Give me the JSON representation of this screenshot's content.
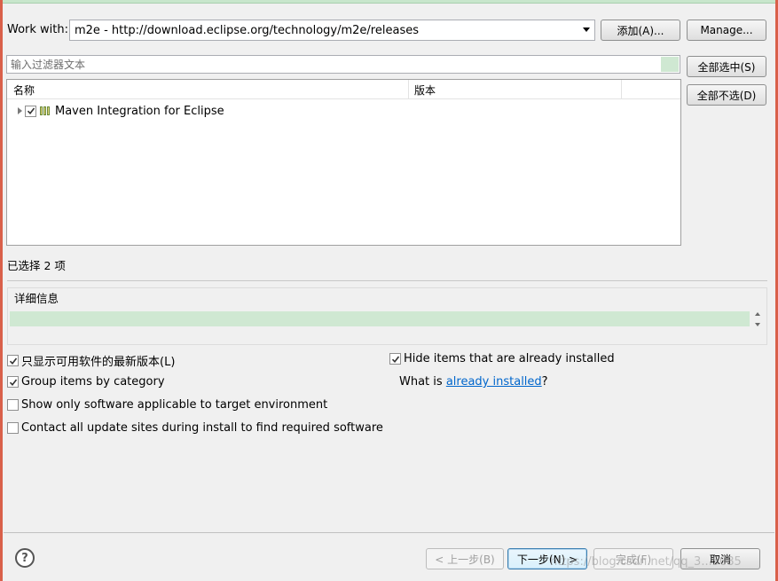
{
  "workwith": {
    "label": "Work with:",
    "value": "m2e - http://download.eclipse.org/technology/m2e/releases",
    "add_button": "添加(A)...",
    "manage_button": "Manage..."
  },
  "filter": {
    "placeholder": "输入过滤器文本",
    "select_all_button": "全部选中(S)",
    "deselect_all_button": "全部不选(D)"
  },
  "tree": {
    "columns": [
      "名称",
      "版本"
    ],
    "rows": [
      {
        "label": "Maven Integration for Eclipse",
        "version": "",
        "checked": true,
        "expanded": false
      }
    ]
  },
  "selection_status": "已选择 2 项",
  "details": {
    "title": "详细信息",
    "text": ""
  },
  "options": {
    "latest_versions": {
      "label": "只显示可用软件的最新版本(L)",
      "checked": true
    },
    "group_by_category": {
      "label": "Group items by category",
      "checked": true
    },
    "target_env": {
      "label": "Show only software applicable to target environment",
      "checked": false
    },
    "contact_sites": {
      "label": "Contact all update sites during install to find required software",
      "checked": false
    },
    "hide_installed": {
      "label": "Hide items that are already installed",
      "checked": true
    },
    "what_is": "What is",
    "already_installed_link": "already installed",
    "question_mark": "?"
  },
  "footer": {
    "help": "?",
    "back_button": "< 上一步(B)",
    "next_button": "下一步(N) >",
    "finish_button": "完成(F)",
    "cancel_button": "取消",
    "watermark": "https://blog.csdn.net/qq_3...5085"
  },
  "colors": {
    "window_border": "#d9604a",
    "filter_highlight": "#cfe8d2",
    "link": "#0066cc"
  }
}
